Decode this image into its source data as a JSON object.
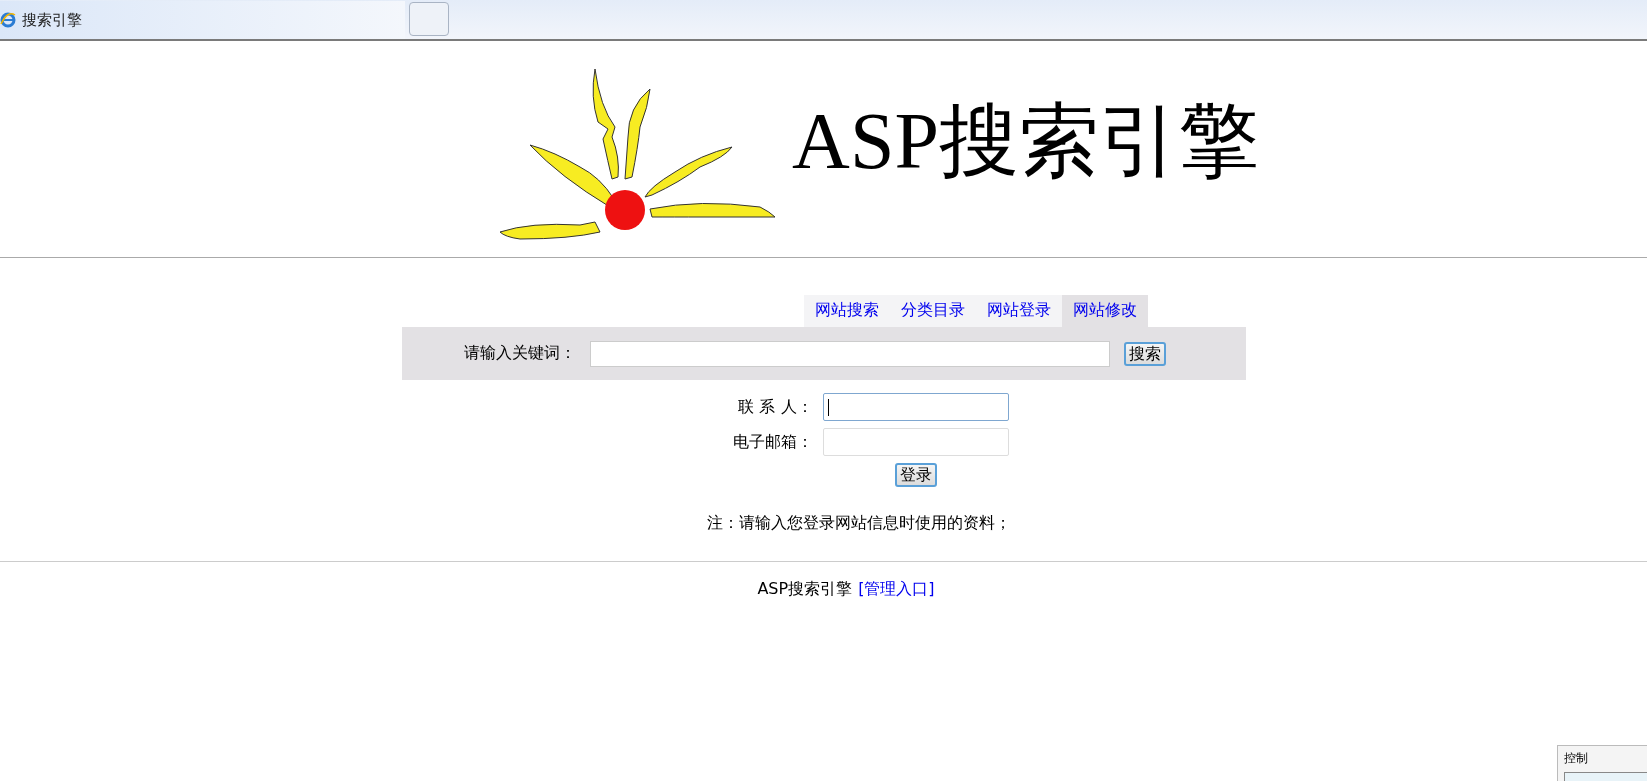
{
  "browser_tab": {
    "title": "搜索引擎"
  },
  "logo": {
    "text": "ASP搜索引擎"
  },
  "tabs": [
    {
      "label": "网站搜索",
      "selected": false
    },
    {
      "label": "分类目录",
      "selected": false
    },
    {
      "label": "网站登录",
      "selected": false
    },
    {
      "label": "网站修改",
      "selected": true
    }
  ],
  "search": {
    "label": "请输入关键词：",
    "button": "搜索"
  },
  "form": {
    "fields": [
      {
        "label": "联 系 人：",
        "focused": true
      },
      {
        "label": "电子邮箱：",
        "focused": false
      }
    ],
    "button": "登录"
  },
  "note": "注：请输入您登录网站信息时使用的资料；",
  "footer": {
    "text": "ASP搜索引擎",
    "link": "[管理入口]"
  },
  "floating_panel": {
    "title": "控制"
  }
}
